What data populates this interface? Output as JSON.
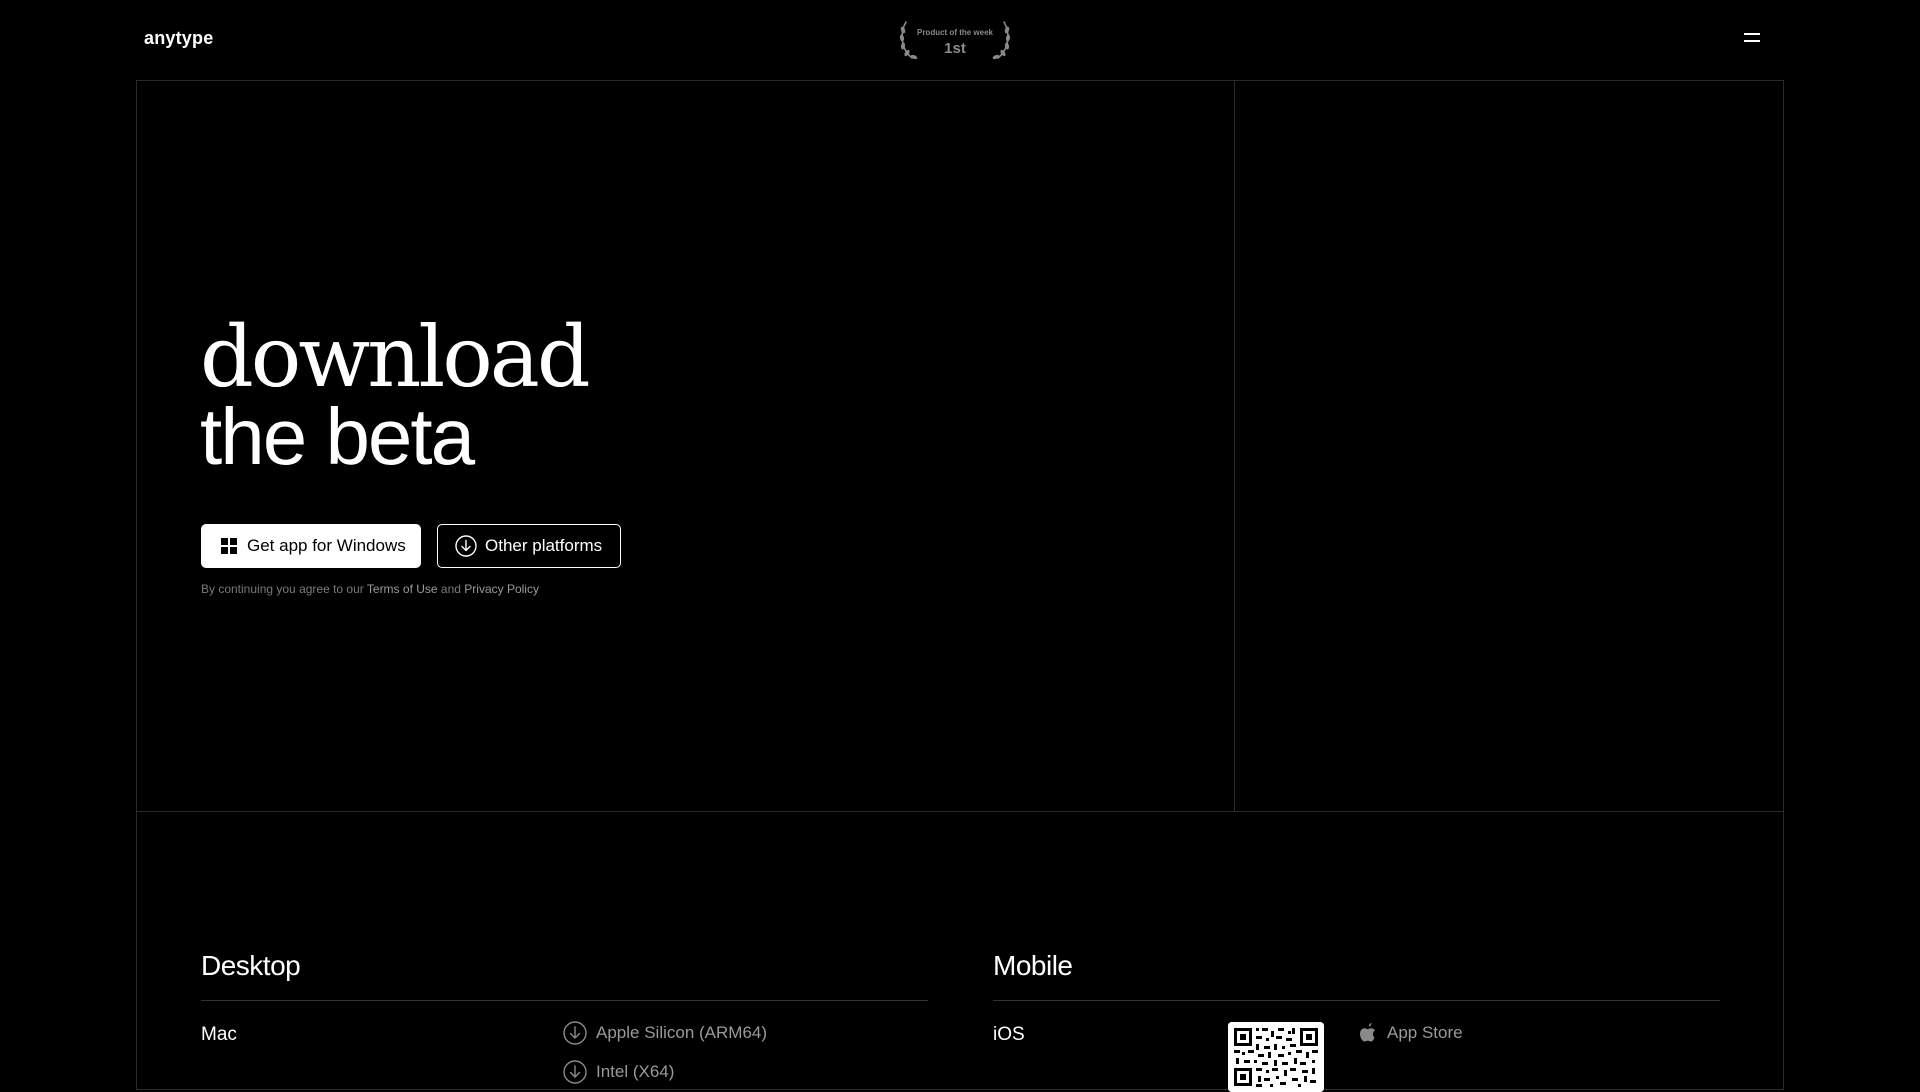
{
  "header": {
    "logo": "anytype",
    "award": {
      "caption": "Product of the week",
      "rank": "1st"
    },
    "menu_icon": "hamburger-icon"
  },
  "hero": {
    "title_line1": "download",
    "title_line2": "the beta",
    "primary_button": "Get app for Windows",
    "primary_icon": "windows-icon",
    "secondary_button": "Other platforms",
    "secondary_icon": "download-icon",
    "legal_prefix": "By continuing you agree to our ",
    "terms_link": "Terms of Use",
    "legal_and": " and ",
    "privacy_link": "Privacy Policy"
  },
  "desktop": {
    "title": "Desktop",
    "platforms": [
      {
        "name": "Mac",
        "links": [
          "Apple Silicon (ARM64)",
          "Intel (X64)"
        ]
      }
    ]
  },
  "mobile": {
    "title": "Mobile",
    "platforms": [
      {
        "name": "iOS",
        "store": "App Store",
        "store_icon": "apple-icon",
        "qr_icon": "qr-code-icon"
      }
    ]
  },
  "colors": {
    "background": "#000000",
    "text": "#ffffff",
    "muted": "#9a9a9a",
    "border": "#2a2a2a"
  }
}
